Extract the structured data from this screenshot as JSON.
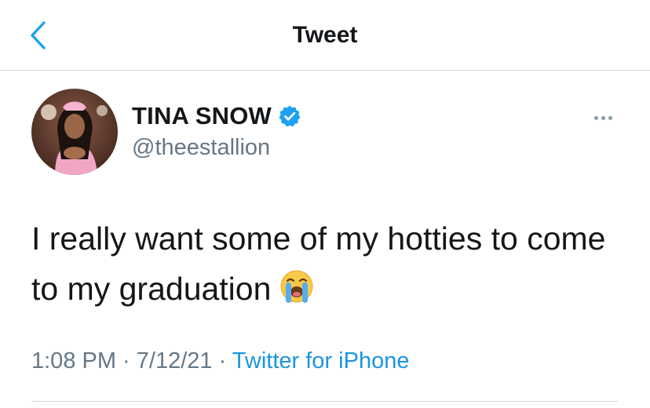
{
  "nav": {
    "back_icon": "chevron-left-icon",
    "title": "Tweet"
  },
  "author": {
    "name": "TINA SNOW",
    "handle": "@theestallion",
    "verified": true,
    "verified_icon": "verified-badge-icon",
    "avatar_icon": "profile-photo"
  },
  "more_icon": "more-horizontal-icon",
  "tweet": {
    "text": "I really want some of my hotties to come to my graduation",
    "emoji": "loudly-crying-face-emoji"
  },
  "meta": {
    "time": "1:08 PM",
    "sep1": " · ",
    "date": "7/12/21",
    "sep2": " · ",
    "source": "Twitter for iPhone"
  },
  "colors": {
    "accent": "#1da1f2",
    "text": "#14171a",
    "secondary": "#657786",
    "link": "#1b95e0"
  }
}
